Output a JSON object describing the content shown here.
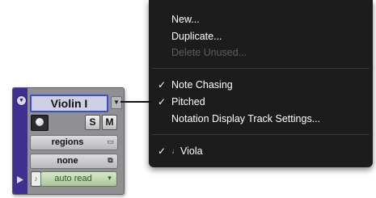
{
  "track": {
    "name": "Violin I",
    "solo_label": "S",
    "mute_label": "M",
    "view_value": "regions",
    "timebase_value": "none",
    "automation_value": "auto read",
    "colors": {
      "strip": "#3f2f8f",
      "name_border": "#3550c8",
      "automation": "#a9c79a"
    },
    "icons": {
      "collapse": "collapse-triangle-icon",
      "menu": "track-menu-arrow-icon",
      "record": "record-circle-icon",
      "play": "play-triangle-icon",
      "voice": "instrument-voice-icon"
    }
  },
  "menu": {
    "items": [
      {
        "label": "New...",
        "enabled": true,
        "checked": false
      },
      {
        "label": "Duplicate...",
        "enabled": true,
        "checked": false
      },
      {
        "label": "Delete Unused...",
        "enabled": false,
        "checked": false
      },
      {
        "label": "Note Chasing",
        "enabled": true,
        "checked": true
      },
      {
        "label": "Pitched",
        "enabled": true,
        "checked": true
      },
      {
        "label": "Notation Display Track Settings...",
        "enabled": true,
        "checked": false
      },
      {
        "label": "Viola",
        "enabled": true,
        "checked": true,
        "icon": "instrument-viola-icon"
      }
    ],
    "check_glyph": "✓",
    "colors": {
      "background": "#101010",
      "text": "#ffffff",
      "disabled_text": "#5d5d5d"
    }
  }
}
